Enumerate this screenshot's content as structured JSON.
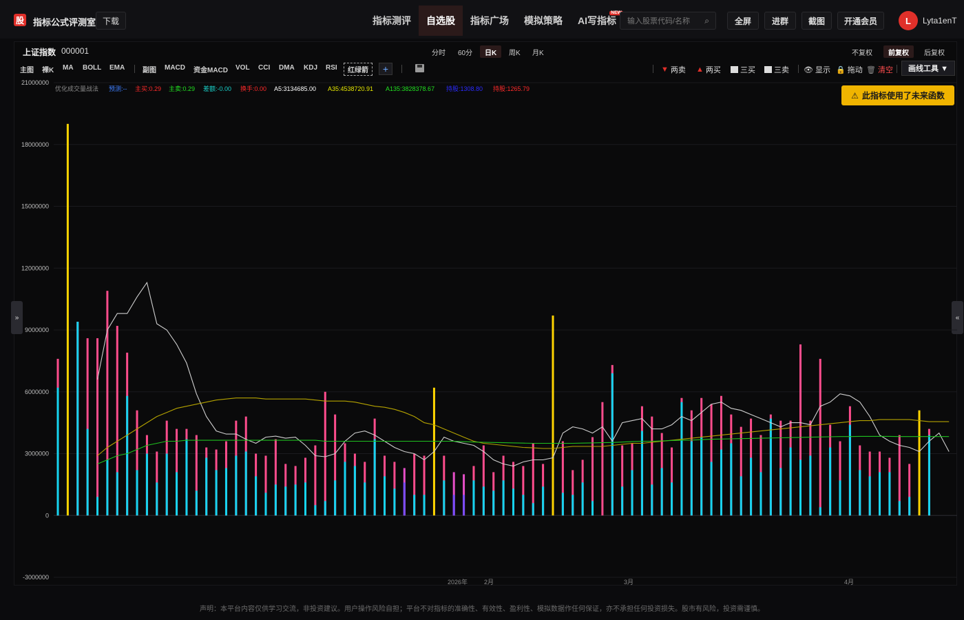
{
  "app": {
    "logo_char": "股",
    "title": "指标公式评测室",
    "download_label": "下载"
  },
  "nav": [
    {
      "label": "指标测评",
      "active": false
    },
    {
      "label": "自选股",
      "active": true
    },
    {
      "label": "指标广场",
      "active": false
    },
    {
      "label": "模拟策略",
      "active": false
    },
    {
      "label": "AI写指标",
      "active": false,
      "badge": "NEW"
    }
  ],
  "search": {
    "placeholder": "输入股票代码/名称",
    "icon": "search-icon"
  },
  "top_buttons": {
    "fullscreen": "全屏",
    "join_group": "进群",
    "screenshot": "截图",
    "vip": "开通会员"
  },
  "user": {
    "avatar_letter": "L",
    "name": "Lyta1enT"
  },
  "symbol": {
    "name": "上证指数",
    "code": "000001"
  },
  "periods": [
    {
      "label": "分时",
      "active": false
    },
    {
      "label": "60分",
      "active": false
    },
    {
      "label": "日K",
      "active": true
    },
    {
      "label": "周K",
      "active": false
    },
    {
      "label": "月K",
      "active": false
    }
  ],
  "adjust": [
    {
      "label": "不复权",
      "active": false
    },
    {
      "label": "前复权",
      "active": true
    },
    {
      "label": "后复权",
      "active": false
    }
  ],
  "indicators": [
    "主图",
    "裸K",
    "MA",
    "BOLL",
    "EMA",
    "副图",
    "MACD",
    "资金MACD",
    "VOL",
    "CCI",
    "DMA",
    "KDJ",
    "RSI",
    "红绿箭"
  ],
  "tools": {
    "two_sell": "两卖",
    "two_buy": "两买",
    "three_buy": "三买",
    "three_sell": "三卖",
    "show": "显示",
    "drag": "拖动",
    "clear": "清空",
    "draw_tools": "画线工具 ▼"
  },
  "warning": "此指标使用了未来函数",
  "legend": {
    "name": "优化成交量战法",
    "forecast": "预测:--",
    "main_sell": "主买:0.29",
    "main_buy": "主卖:0.29",
    "diff": "差额:-0.00",
    "turnover": "换手:0.00",
    "a5": "A5:3134685.00",
    "a35": "A35:4538720.91",
    "a135": "A135:3828378.67",
    "hold_blue": "持股:1308.80",
    "hold_red": "持股:1265.79"
  },
  "colors": {
    "accent_red": "#e0302a",
    "bar_pink": "#ff4d8d",
    "bar_cyan": "#16d4f0",
    "bar_yellow": "#ffd400",
    "line_white": "#cfcfcf",
    "line_olive": "#b5a300",
    "line_green": "#1fc21f"
  },
  "chart_data": {
    "type": "bar",
    "ylim": [
      -3000000,
      21000000
    ],
    "yticks": [
      "21000000",
      "18000000",
      "15000000",
      "12000000",
      "9000000",
      "6000000",
      "3000000",
      "0",
      "-3000000"
    ],
    "xlabels": [
      "2026年",
      "2月",
      "3月",
      "4月"
    ],
    "bars": [
      {
        "total": 7600000,
        "inner": 6200000,
        "kind": "normal"
      },
      {
        "total": 19000000,
        "inner": 0,
        "kind": "yellow"
      },
      {
        "total": 9400000,
        "inner": 9400000,
        "kind": "normal"
      },
      {
        "total": 8600000,
        "inner": 4200000,
        "kind": "normal"
      },
      {
        "total": 8600000,
        "inner": 900000,
        "kind": "normal"
      },
      {
        "total": 10900000,
        "inner": 2700000,
        "kind": "normal"
      },
      {
        "total": 9200000,
        "inner": 2100000,
        "kind": "normal"
      },
      {
        "total": 7900000,
        "inner": 5800000,
        "kind": "normal"
      },
      {
        "total": 5100000,
        "inner": 2200000,
        "kind": "normal"
      },
      {
        "total": 3900000,
        "inner": 3000000,
        "kind": "normal"
      },
      {
        "total": 3100000,
        "inner": 1600000,
        "kind": "normal"
      },
      {
        "total": 4600000,
        "inner": 3000000,
        "kind": "normal"
      },
      {
        "total": 4200000,
        "inner": 2100000,
        "kind": "normal"
      },
      {
        "total": 4200000,
        "inner": 3700000,
        "kind": "normal"
      },
      {
        "total": 3900000,
        "inner": 1200000,
        "kind": "normal"
      },
      {
        "total": 3300000,
        "inner": 2800000,
        "kind": "normal"
      },
      {
        "total": 3200000,
        "inner": 2200000,
        "kind": "normal"
      },
      {
        "total": 3600000,
        "inner": 2300000,
        "kind": "normal"
      },
      {
        "total": 4600000,
        "inner": 2900000,
        "kind": "normal"
      },
      {
        "total": 4800000,
        "inner": 3100000,
        "kind": "normal"
      },
      {
        "total": 3000000,
        "inner": 1900000,
        "kind": "normal"
      },
      {
        "total": 2900000,
        "inner": 1100000,
        "kind": "normal"
      },
      {
        "total": 3700000,
        "inner": 1500000,
        "kind": "normal"
      },
      {
        "total": 2500000,
        "inner": 1400000,
        "kind": "normal"
      },
      {
        "total": 2400000,
        "inner": 1500000,
        "kind": "normal"
      },
      {
        "total": 2800000,
        "inner": 1600000,
        "kind": "normal"
      },
      {
        "total": 3400000,
        "inner": 500000,
        "kind": "normal"
      },
      {
        "total": 6000000,
        "inner": 700000,
        "kind": "normal"
      },
      {
        "total": 4900000,
        "inner": 1700000,
        "kind": "normal"
      },
      {
        "total": 3500000,
        "inner": 2600000,
        "kind": "normal"
      },
      {
        "total": 3000000,
        "inner": 2400000,
        "kind": "normal"
      },
      {
        "total": 2600000,
        "inner": 1600000,
        "kind": "normal"
      },
      {
        "total": 4700000,
        "inner": 3700000,
        "kind": "normal"
      },
      {
        "total": 2900000,
        "inner": 1900000,
        "kind": "normal"
      },
      {
        "total": 2600000,
        "inner": 1300000,
        "kind": "normal"
      },
      {
        "total": 2300000,
        "inner": 1600000,
        "kind": "purple"
      },
      {
        "total": 3000000,
        "inner": 1000000,
        "kind": "normal"
      },
      {
        "total": 2900000,
        "inner": 1000000,
        "kind": "normal"
      },
      {
        "total": 6200000,
        "inner": 0,
        "kind": "yellow"
      },
      {
        "total": 2900000,
        "inner": 1700000,
        "kind": "normal"
      },
      {
        "total": 2100000,
        "inner": 1000000,
        "kind": "purple"
      },
      {
        "total": 2000000,
        "inner": 1000000,
        "kind": "purple"
      },
      {
        "total": 2400000,
        "inner": 1700000,
        "kind": "normal"
      },
      {
        "total": 3400000,
        "inner": 1400000,
        "kind": "normal"
      },
      {
        "total": 2100000,
        "inner": 1200000,
        "kind": "normal"
      },
      {
        "total": 2900000,
        "inner": 1700000,
        "kind": "normal"
      },
      {
        "total": 2600000,
        "inner": 1300000,
        "kind": "normal"
      },
      {
        "total": 2400000,
        "inner": 1000000,
        "kind": "normal"
      },
      {
        "total": 3500000,
        "inner": 600000,
        "kind": "normal"
      },
      {
        "total": 2500000,
        "inner": 1400000,
        "kind": "normal"
      },
      {
        "total": 9700000,
        "inner": 0,
        "kind": "yellow"
      },
      {
        "total": 3600000,
        "inner": 1100000,
        "kind": "normal"
      },
      {
        "total": 2200000,
        "inner": 1000000,
        "kind": "normal"
      },
      {
        "total": 2700000,
        "inner": 1600000,
        "kind": "normal"
      },
      {
        "total": 3800000,
        "inner": 700000,
        "kind": "normal"
      },
      {
        "total": 5500000,
        "inner": 0,
        "kind": "normal"
      },
      {
        "total": 7300000,
        "inner": 6900000,
        "kind": "normal"
      },
      {
        "total": 3400000,
        "inner": 1400000,
        "kind": "normal"
      },
      {
        "total": 3500000,
        "inner": 2200000,
        "kind": "normal"
      },
      {
        "total": 5300000,
        "inner": 4100000,
        "kind": "normal"
      },
      {
        "total": 4800000,
        "inner": 1500000,
        "kind": "normal"
      },
      {
        "total": 4000000,
        "inner": 2300000,
        "kind": "normal"
      },
      {
        "total": 3300000,
        "inner": 1600000,
        "kind": "normal"
      },
      {
        "total": 5700000,
        "inner": 5500000,
        "kind": "normal"
      },
      {
        "total": 5100000,
        "inner": 3600000,
        "kind": "normal"
      },
      {
        "total": 5700000,
        "inner": 3800000,
        "kind": "normal"
      },
      {
        "total": 5400000,
        "inner": 2600000,
        "kind": "normal"
      },
      {
        "total": 5800000,
        "inner": 3200000,
        "kind": "normal"
      },
      {
        "total": 4900000,
        "inner": 3500000,
        "kind": "normal"
      },
      {
        "total": 4300000,
        "inner": 1900000,
        "kind": "normal"
      },
      {
        "total": 4700000,
        "inner": 2800000,
        "kind": "normal"
      },
      {
        "total": 3900000,
        "inner": 2100000,
        "kind": "normal"
      },
      {
        "total": 4900000,
        "inner": 4700000,
        "kind": "normal"
      },
      {
        "total": 4600000,
        "inner": 2300000,
        "kind": "normal"
      },
      {
        "total": 4600000,
        "inner": 3300000,
        "kind": "normal"
      },
      {
        "total": 8300000,
        "inner": 2700000,
        "kind": "normal"
      },
      {
        "total": 4600000,
        "inner": 2900000,
        "kind": "normal"
      },
      {
        "total": 7600000,
        "inner": 400000,
        "kind": "normal"
      },
      {
        "total": 4400000,
        "inner": 3300000,
        "kind": "normal"
      },
      {
        "total": 3600000,
        "inner": 1700000,
        "kind": "normal"
      },
      {
        "total": 5300000,
        "inner": 4400000,
        "kind": "normal"
      },
      {
        "total": 3400000,
        "inner": 2200000,
        "kind": "normal"
      },
      {
        "total": 3100000,
        "inner": 1900000,
        "kind": "normal"
      },
      {
        "total": 3100000,
        "inner": 2100000,
        "kind": "normal"
      },
      {
        "total": 2800000,
        "inner": 2100000,
        "kind": "normal"
      },
      {
        "total": 3900000,
        "inner": 700000,
        "kind": "normal"
      },
      {
        "total": 2500000,
        "inner": 900000,
        "kind": "normal"
      },
      {
        "total": 5100000,
        "inner": 0,
        "kind": "yellow"
      },
      {
        "total": 4200000,
        "inner": 3900000,
        "kind": "normal"
      },
      {
        "total": 0,
        "inner": 0,
        "kind": "normal"
      }
    ],
    "series": [
      {
        "name": "A5",
        "color": "#cfcfcf",
        "values": [
          null,
          null,
          null,
          null,
          6600000,
          9000000,
          9800000,
          9800000,
          10600000,
          11300000,
          9300000,
          9000000,
          8300000,
          7400000,
          5900000,
          4800000,
          4100000,
          3950000,
          3950000,
          3700000,
          3500000,
          3800000,
          3850000,
          3750000,
          3800000,
          3400000,
          2900000,
          2850000,
          3000000,
          3600000,
          4000000,
          4100000,
          3900000,
          3600000,
          3300000,
          3100000,
          3000000,
          2700000,
          3100000,
          3800000,
          3600000,
          3500000,
          3400000,
          3100000,
          2700000,
          2500000,
          2400000,
          2600000,
          2700000,
          2700000,
          2800000,
          4000000,
          4300000,
          4200000,
          4000000,
          4300000,
          3600000,
          4500000,
          4600000,
          4700000,
          4200000,
          4200000,
          4400000,
          4800000,
          4600000,
          5000000,
          5400000,
          5500000,
          5200000,
          5100000,
          4900000,
          4700000,
          4500000,
          4300000,
          4500000,
          4500000,
          4400000,
          5300000,
          5500000,
          5900000,
          5800000,
          5500000,
          4800000,
          3900000,
          3600000,
          3400000,
          3300000,
          3100000,
          3600000,
          4000000,
          3100000
        ]
      },
      {
        "name": "A35",
        "color": "#b5a300",
        "values": [
          null,
          null,
          null,
          null,
          2900000,
          3300000,
          3600000,
          3900000,
          4200000,
          4500000,
          4800000,
          5000000,
          5200000,
          5300000,
          5400000,
          5500000,
          5600000,
          5650000,
          5700000,
          5700000,
          5700000,
          5650000,
          5650000,
          5650000,
          5650000,
          5650000,
          5600000,
          5550000,
          5550000,
          5550000,
          5500000,
          5400000,
          5300000,
          5250000,
          5150000,
          5000000,
          4800000,
          4500000,
          4400000,
          4200000,
          4000000,
          3800000,
          3600000,
          3500000,
          3450000,
          3400000,
          3350000,
          3300000,
          3280000,
          3250000,
          3250000,
          3300000,
          3350000,
          3350000,
          3350000,
          3350000,
          3400000,
          3450000,
          3500000,
          3500000,
          3550000,
          3600000,
          3650000,
          3700000,
          3750000,
          3800000,
          3850000,
          3900000,
          3950000,
          4000000,
          4050000,
          4100000,
          4150000,
          4200000,
          4250000,
          4300000,
          4350000,
          4400000,
          4450000,
          4500000,
          4550000,
          4600000,
          4600000,
          4650000,
          4650000,
          4650000,
          4650000,
          4600000,
          4550000,
          4550000,
          4550000
        ]
      },
      {
        "name": "A135",
        "color": "#1fc21f",
        "values": [
          null,
          null,
          null,
          null,
          2500000,
          2700000,
          2900000,
          3000000,
          3200000,
          3400000,
          3500000,
          3600000,
          3600000,
          3650000,
          3650000,
          3650000,
          3650000,
          3650000,
          3650000,
          3650000,
          3650000,
          3650000,
          3650000,
          3650000,
          3650000,
          3650000,
          3650000,
          3600000,
          3600000,
          3600000,
          3600000,
          3600000,
          3600000,
          3600000,
          3600000,
          3600000,
          3600000,
          3600000,
          3600000,
          3600000,
          3600000,
          3580000,
          3560000,
          3550000,
          3540000,
          3530000,
          3520000,
          3510000,
          3500000,
          3500000,
          3500000,
          3500000,
          3500000,
          3510000,
          3520000,
          3530000,
          3540000,
          3560000,
          3580000,
          3600000,
          3600000,
          3620000,
          3640000,
          3650000,
          3660000,
          3680000,
          3700000,
          3710000,
          3720000,
          3730000,
          3740000,
          3750000,
          3760000,
          3770000,
          3780000,
          3790000,
          3800000,
          3810000,
          3820000,
          3830000,
          3830000,
          3840000,
          3840000,
          3840000,
          3840000,
          3830000,
          3830000,
          3830000,
          3830000,
          3830000,
          3830000
        ]
      }
    ]
  },
  "side": {
    "left_handle": "»",
    "right_handle": "«"
  },
  "disclaimer": "声明：本平台内容仅供学习交流，非投资建议。用户操作风险自担；平台不对指标的准确性、有效性、盈利性、模拟数据作任何保证，亦不承担任何投资损失。股市有风险，投资需谨慎。"
}
